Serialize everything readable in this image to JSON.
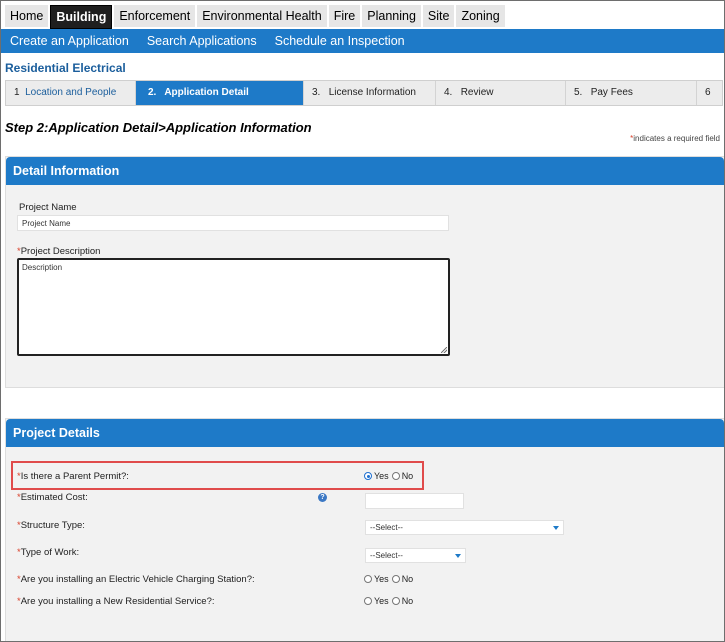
{
  "top_nav": [
    "Home",
    "Building",
    "Enforcement",
    "Environmental Health",
    "Fire",
    "Planning",
    "Site",
    "Zoning"
  ],
  "active_top_tab": "Building",
  "sub_nav": [
    "Create an Application",
    "Search Applications",
    "Schedule an Inspection"
  ],
  "permit_title": "Residential Electrical",
  "steps": [
    {
      "num": "1",
      "label": "Location and People"
    },
    {
      "num": "2.",
      "label": "Application Detail"
    },
    {
      "num": "3.",
      "label": "License Information"
    },
    {
      "num": "4.",
      "label": "Review"
    },
    {
      "num": "5.",
      "label": "Pay Fees"
    },
    {
      "num": "6",
      "label": ""
    }
  ],
  "step_heading": "Step 2:Application Detail>Application Information",
  "required_note": "indicates a required field",
  "detail_section": {
    "title": "Detail Information",
    "project_name_label": "Project Name",
    "project_name_value": "Project Name",
    "project_description_label": "Project Description",
    "project_description_value": "Description"
  },
  "project_details": {
    "title": "Project Details",
    "parent_permit_label": "Is there a Parent Permit?:",
    "estimated_cost_label": "Estimated Cost:",
    "structure_type_label": "Structure Type:",
    "structure_type_value": "--Select--",
    "type_of_work_label": "Type of Work:",
    "type_of_work_value": "--Select--",
    "ev_station_label": "Are you installing an Electric Vehicle Charging Station?:",
    "new_service_label": "Are you installing a New Residential Service?:",
    "yes_label": "Yes",
    "no_label": "No",
    "parent_permit_selected": "Yes"
  },
  "icons": {
    "help": "help-icon",
    "dropdown": "chevron-down-icon"
  },
  "colors": {
    "primary_blue": "#1e7ac8",
    "required_star": "#d9412b",
    "highlight_red": "#e04b4b"
  }
}
